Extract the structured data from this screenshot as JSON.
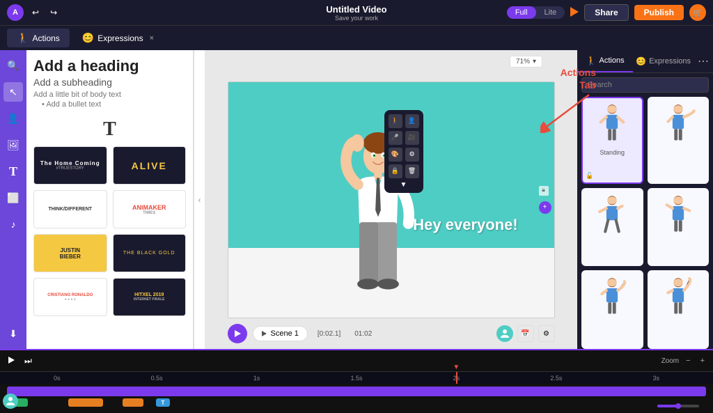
{
  "header": {
    "title": "Untitled Video",
    "subtitle": "Save your work",
    "logo": "A",
    "mode": {
      "options": [
        "Full",
        "Lite"
      ],
      "active": "Full"
    },
    "share_label": "Share",
    "publish_label": "Publish"
  },
  "tabs_bar": {
    "tabs": [
      {
        "id": "actions",
        "icon": "🚶",
        "label": "Actions",
        "active": true
      },
      {
        "id": "expressions",
        "icon": "😊",
        "label": "Expressions",
        "active": false
      }
    ]
  },
  "left_sidebar": {
    "icons": [
      {
        "name": "search",
        "symbol": "🔍"
      },
      {
        "name": "cursor",
        "symbol": "↖"
      },
      {
        "name": "person",
        "symbol": "👤"
      },
      {
        "name": "image",
        "symbol": "🖼"
      },
      {
        "name": "text-T",
        "symbol": "T"
      },
      {
        "name": "shapes",
        "symbol": "⬜"
      },
      {
        "name": "music",
        "symbol": "♪"
      },
      {
        "name": "down-arrow",
        "symbol": "⬇"
      }
    ]
  },
  "templates_panel": {
    "heading": "Add a heading",
    "subheading": "Add a subheading",
    "body_text": "Add a little bit of body text",
    "bullet_text": "Add a bullet text",
    "items": [
      {
        "id": "home-coming",
        "label": "The Home Coming",
        "sub": "#TRUESTORY",
        "style": "dark"
      },
      {
        "id": "alive",
        "label": "ALIVE",
        "style": "alive"
      },
      {
        "id": "think-different",
        "label": "THINK/DIFFERENT",
        "style": "think"
      },
      {
        "id": "animaker",
        "label": "ANIMAKER TIMES",
        "style": "animaker"
      },
      {
        "id": "justin-bieber",
        "label": "JUSTIN BIEBER",
        "style": "justin"
      },
      {
        "id": "black-gold",
        "label": "THE BLACK GOLD",
        "style": "blackgold"
      },
      {
        "id": "cr7",
        "label": "CRISTIANO RONALDO",
        "style": "cr7"
      },
      {
        "id": "hitxel",
        "label": "HITXEL 2019",
        "style": "hitxel"
      }
    ]
  },
  "canvas": {
    "zoom": "71%",
    "scene_text": "Hey everyone!",
    "scene_label": "Scene 1",
    "time_start": "[0:02.1]",
    "time_end": "01:02"
  },
  "right_panel": {
    "tabs": [
      {
        "id": "actions",
        "icon": "🚶",
        "label": "Actions",
        "active": true
      },
      {
        "id": "expressions",
        "icon": "😊",
        "label": "Expressions",
        "active": false
      }
    ],
    "search_placeholder": "Search",
    "characters": [
      {
        "id": "standing",
        "label": "Standing",
        "selected": true
      },
      {
        "id": "pointing",
        "label": "",
        "selected": false
      },
      {
        "id": "walking",
        "label": "",
        "selected": false
      },
      {
        "id": "talking",
        "label": "",
        "selected": false
      },
      {
        "id": "thinking",
        "label": "",
        "selected": false
      },
      {
        "id": "waving",
        "label": "",
        "selected": false
      }
    ]
  },
  "annotation": {
    "text": "Actions\nTab",
    "color": "#e74c3c"
  },
  "timeline": {
    "time_marks": [
      "0s",
      "0.5s",
      "1s",
      "1.5s",
      "2s",
      "2.5s",
      "3s"
    ],
    "zoom_label": "Zoom"
  }
}
